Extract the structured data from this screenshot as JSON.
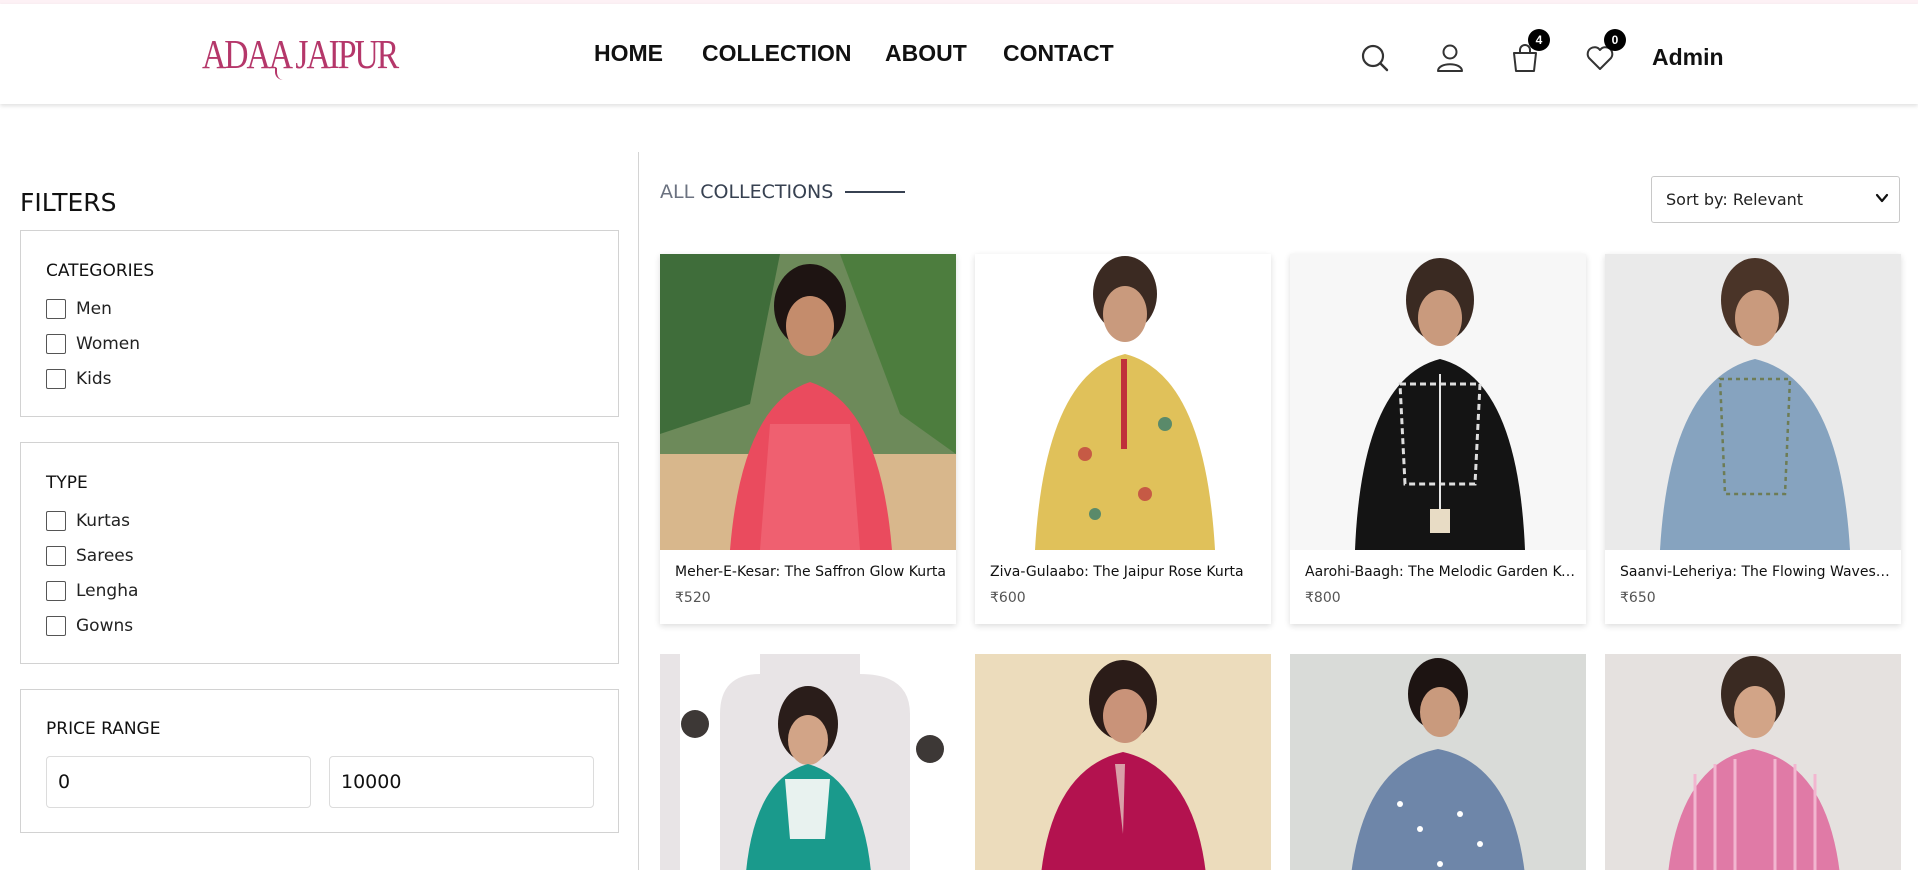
{
  "brand": {
    "logo_text": "ADAA JAIPUR",
    "color": "#b5376a"
  },
  "nav": {
    "items": [
      "HOME",
      "COLLECTION",
      "ABOUT",
      "CONTACT"
    ]
  },
  "header_icons": [
    "search-icon",
    "user-icon",
    "bag-icon",
    "heart-icon"
  ],
  "cart_count": "4",
  "wishlist_count": "0",
  "user_label": "Admin",
  "filters": {
    "title": "FILTERS",
    "categories": {
      "heading": "CATEGORIES",
      "options": [
        "Men",
        "Women",
        "Kids"
      ]
    },
    "type": {
      "heading": "TYPE",
      "options": [
        "Kurtas",
        "Sarees",
        "Lengha",
        "Gowns"
      ]
    },
    "price_range": {
      "heading": "PRICE RANGE",
      "min": "0",
      "max": "10000"
    }
  },
  "collection": {
    "title_part1": "ALL",
    "title_part2": "COLLECTIONS"
  },
  "sort": {
    "selected": "Sort by: Relevant"
  },
  "products": [
    {
      "name": "Meher-E-Kesar: The Saffron Glow Kurta",
      "price": "₹520"
    },
    {
      "name": "Ziva-Gulaabo: The Jaipur Rose Kurta",
      "price": "₹600"
    },
    {
      "name": "Aarohi-Baagh: The Melodic Garden Kurta",
      "price": "₹800"
    },
    {
      "name": "Saanvi-Leheriya: The Flowing Waves Kurta",
      "price": "₹650"
    }
  ]
}
